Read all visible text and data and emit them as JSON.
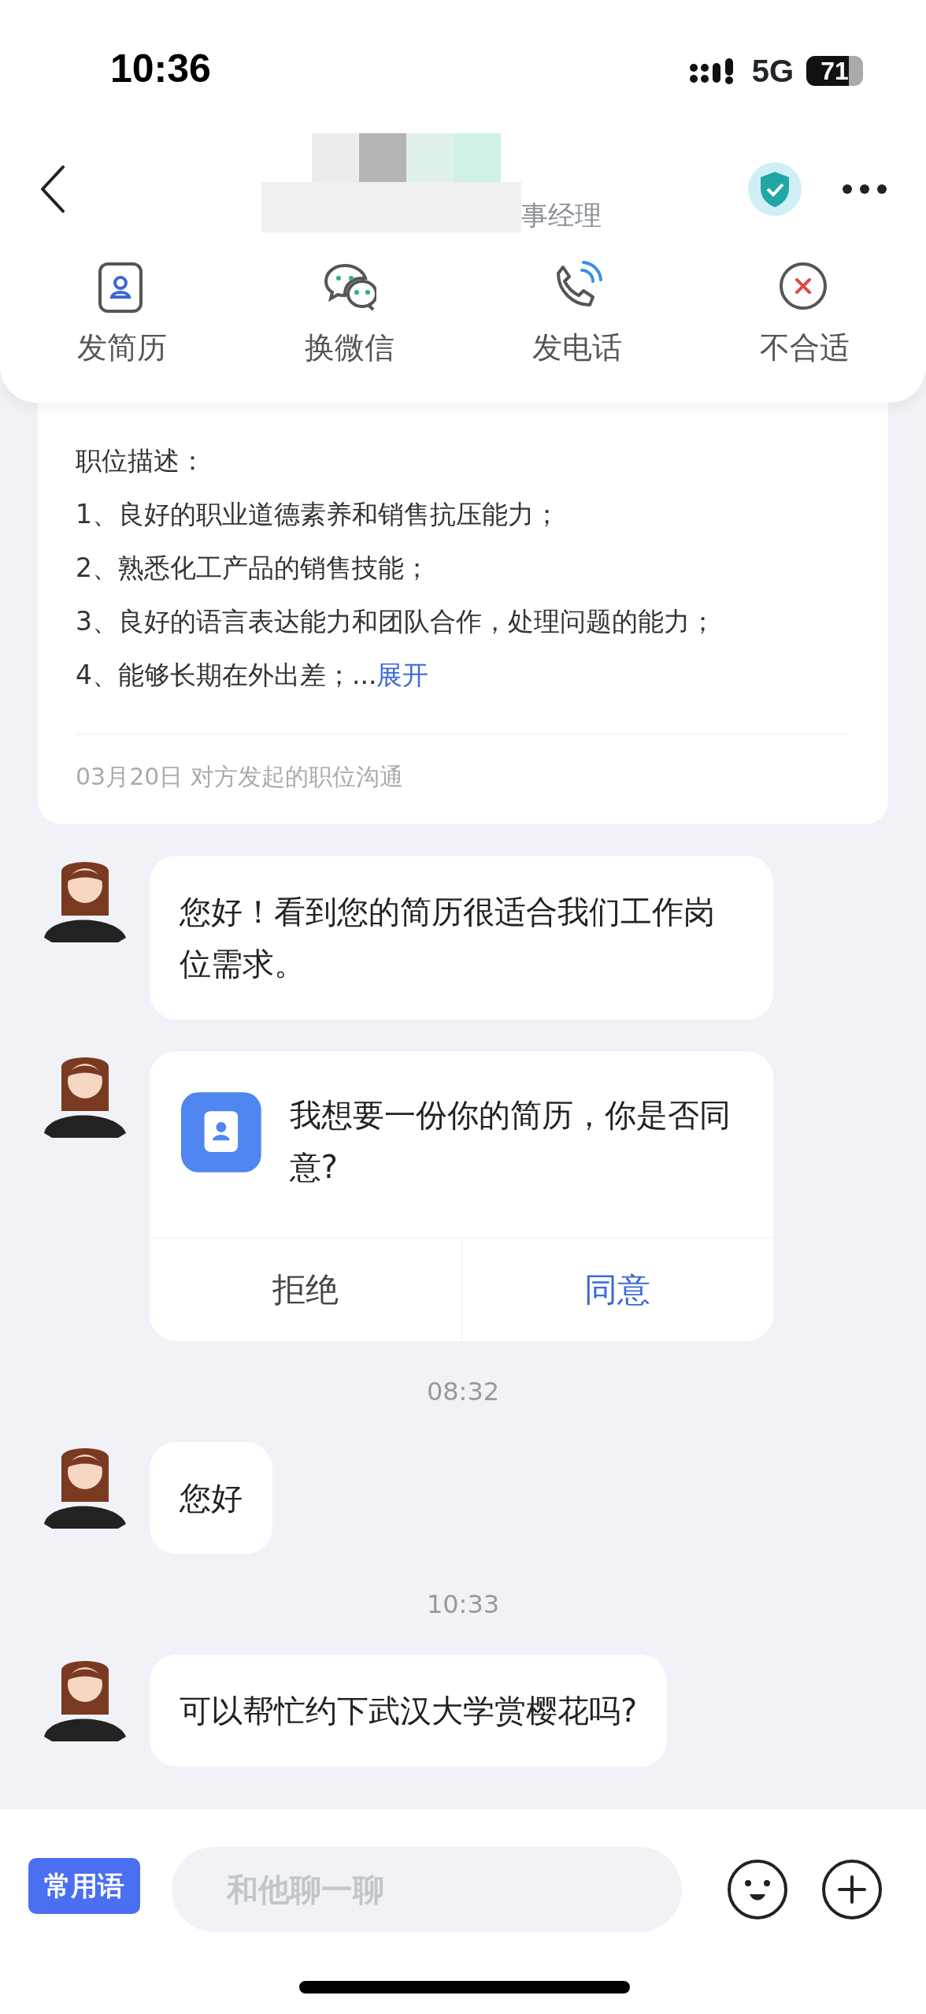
{
  "status_bar": {
    "time": "10:36",
    "network": "5G",
    "battery": "71"
  },
  "header": {
    "subtitle": "事经理"
  },
  "actions": [
    {
      "label": "发简历",
      "kind": "resume"
    },
    {
      "label": "换微信",
      "kind": "wechat"
    },
    {
      "label": "发电话",
      "kind": "phone"
    },
    {
      "label": "不合适",
      "kind": "reject"
    }
  ],
  "job_card": {
    "heading": "职位描述：",
    "lines": [
      "1、良好的职业道德素养和销售抗压能力；",
      "2、熟悉化工产品的销售技能；",
      "3、良好的语言表达能力和团队合作，处理问题的能力；",
      "4、能够长期在外出差；..."
    ],
    "expand_link": "展开",
    "footer": "03月20日  对方发起的职位沟通"
  },
  "messages": [
    {
      "kind": "text",
      "text": "您好！看到您的简历很适合我们工作岗位需求。"
    },
    {
      "kind": "request",
      "text": "我想要一份你的简历，你是否同意?",
      "buttons": [
        {
          "label": "拒绝",
          "primary": false
        },
        {
          "label": "同意",
          "primary": true
        }
      ]
    },
    {
      "kind": "time",
      "text": "08:32"
    },
    {
      "kind": "text",
      "text": "您好"
    },
    {
      "kind": "time",
      "text": "10:33"
    },
    {
      "kind": "text",
      "text": "可以帮忙约下武汉大学赏樱花吗?"
    }
  ],
  "composer": {
    "quick_button": "常用语",
    "placeholder": "和他聊一聊"
  }
}
